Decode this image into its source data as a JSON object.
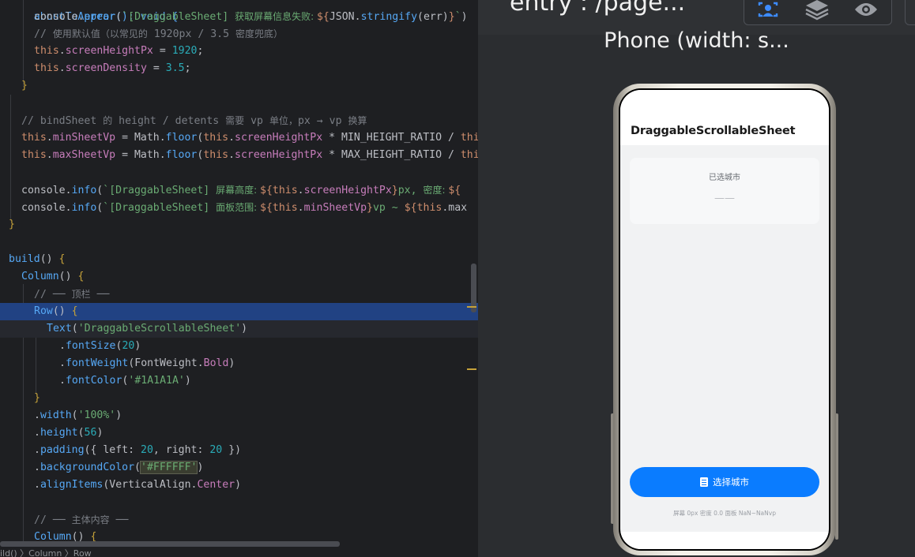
{
  "editor": {
    "lines": [
      [
        "aboutToAppear(): void {"
      ],
      [
        "console.error(`[DraggableSheet] 获取屏幕信息失败: ${JSON.stringify(err)}`)"
      ],
      [
        "// 使用默认值（以常见的 1920px / 3.5 密度兜底）"
      ],
      [
        "this.screenHeightPx = 1920;"
      ],
      [
        "this.screenDensity = 3.5;"
      ],
      [
        "}"
      ],
      [
        "// bindSheet 的 height / detents 需要 vp 单位，px → vp 换算"
      ],
      [
        "this.minSheetVp = Math.floor(this.screenHeightPx * MIN_HEIGHT_RATIO / this"
      ],
      [
        "this.maxSheetVp = Math.floor(this.screenHeightPx * MAX_HEIGHT_RATIO / this"
      ],
      [
        "console.info(`[DraggableSheet] 屏幕高度: ${this.screenHeightPx}px, 密度: ${"
      ],
      [
        "console.info(`[DraggableSheet] 面板范围: ${this.minSheetVp}vp ~ ${this.max"
      ],
      [
        "}"
      ],
      [
        "build() {"
      ],
      [
        "Column() {"
      ],
      [
        "// ── 顶栏 ──"
      ],
      [
        "Row() {"
      ],
      [
        "Text('DraggableScrollableSheet')"
      ],
      [
        ".fontSize(20)"
      ],
      [
        ".fontWeight(FontWeight.Bold)"
      ],
      [
        ".fontColor('#1A1A1A')"
      ],
      [
        "}"
      ],
      [
        ".width('100%')"
      ],
      [
        ".height(56)"
      ],
      [
        ".padding({ left: 20, right: 20 })"
      ],
      [
        ".backgroundColor('#FFFFFF')"
      ],
      [
        ".alignItems(VerticalAlign.Center)"
      ],
      [
        "// ── 主体内容 ──"
      ],
      [
        "Column() {"
      ]
    ],
    "breadcrumb": "ild() 〉Column 〉Row"
  },
  "previewer": {
    "entry_title": "entry : /page...",
    "device_label": "Phone (width: s...",
    "tools": [
      {
        "icon": "inspector-icon",
        "active": true
      },
      {
        "icon": "layers-icon",
        "active": false
      },
      {
        "icon": "eye-icon",
        "active": false
      }
    ]
  },
  "app": {
    "title": "DraggableScrollableSheet",
    "city_card": {
      "label": "已选城市",
      "value": "——"
    },
    "select_button": {
      "label": "选择城市",
      "icon": "clipboard-icon"
    },
    "footer_info": "屏幕 0px 密度 0.0   面板 NaN~NaNvp"
  },
  "colors": {
    "primary_button": "#0a7cff",
    "editor_bg": "#1e1f22",
    "current_line": "#214283"
  }
}
